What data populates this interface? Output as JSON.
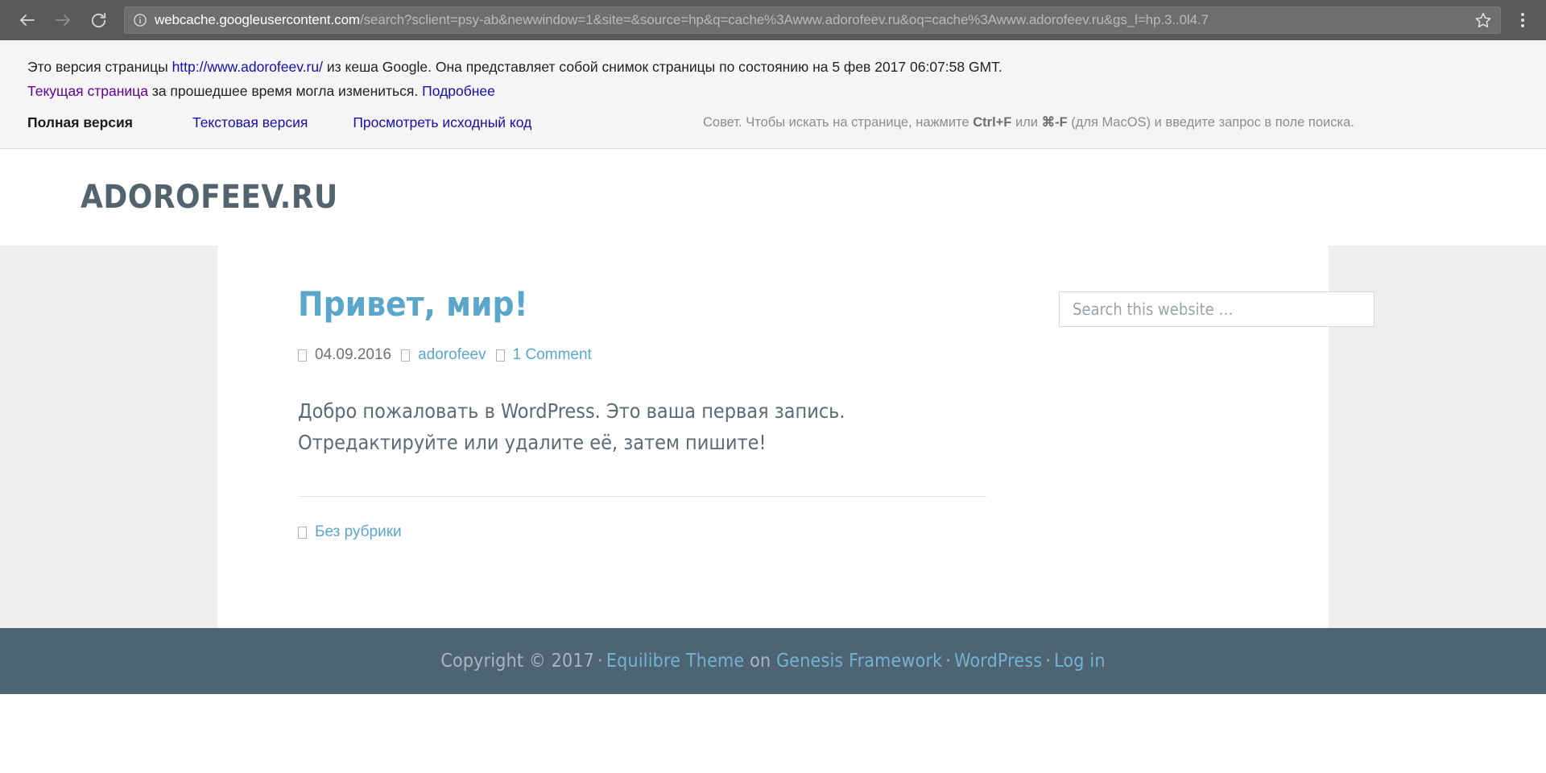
{
  "browser": {
    "back_icon": "arrow-left-icon",
    "forward_icon": "arrow-right-icon",
    "reload_icon": "reload-icon",
    "info_icon": "info-circle-icon",
    "bookmark_icon": "star-icon",
    "menu_icon": "kebab-menu-icon",
    "url_host": "webcache.googleusercontent.com",
    "url_rest": "/search?sclient=psy-ab&newwindow=1&site=&source=hp&q=cache%3Awww.adorofeev.ru&oq=cache%3Awww.adorofeev.ru&gs_l=hp.3..0l4.7",
    "url_full": "webcache.googleusercontent.com/search?sclient=psy-ab&newwindow=1&site=&source=hp&q=cache%3Awww.adorofeev.ru&oq=cache%3Awww.adorofeev.ru&gs_l=hp.3..0l4.7"
  },
  "cache_banner": {
    "line1_prefix": "Это версия страницы ",
    "line1_link": "http://www.adorofeev.ru/",
    "line1_suffix": " из кеша Google. Она представляет собой снимок страницы по состоянию на 5 фев 2017 06:07:58 GMT.",
    "line2_link_current": "Текущая страница",
    "line2_middle": " за прошедшее время могла измениться. ",
    "line2_link_more": "Подробнее",
    "tab_full": "Полная версия",
    "tab_text": "Текстовая версия",
    "tab_source": "Просмотреть исходный код",
    "hint_part1": "Совет. Чтобы искать на странице, нажмите ",
    "hint_key1": "Ctrl+F",
    "hint_part2": " или ",
    "hint_key2": "⌘-F",
    "hint_part3": " (для MacOS) и введите запрос в поле поиска."
  },
  "site": {
    "title": "ADOROFEEV.RU"
  },
  "post": {
    "title": "Привет, мир!",
    "date": "04.09.2016",
    "author": "adorofeev",
    "comments": "1 Comment",
    "body": "Добро пожаловать в WordPress. Это ваша первая запись. Отредактируйте или удалите её, затем пишите!",
    "category": "Без рубрики",
    "meta_icon": "missing-glyph-box-icon"
  },
  "sidebar": {
    "search_placeholder": "Search this website …",
    "search_value": ""
  },
  "footer": {
    "copyright": "Copyright © 2017",
    "dot": "·",
    "theme_link": "Equilibre Theme",
    "on_text": "on",
    "framework_link": "Genesis Framework",
    "wordpress_link": "WordPress",
    "login_link": "Log in"
  },
  "colors": {
    "chrome_bg": "#5a5a5a",
    "banner_bg": "#f5f5f5",
    "link_blue": "#1a0dab",
    "link_purple": "#660099",
    "site_title": "#53646f",
    "accent_blue": "#5ba7cc",
    "footer_bg": "#4e6472",
    "body_bg": "#efefef"
  }
}
